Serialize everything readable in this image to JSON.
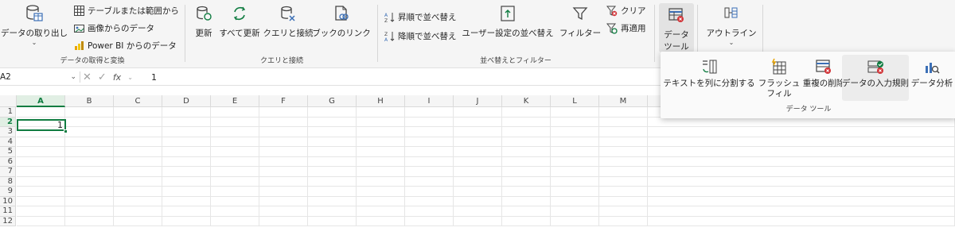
{
  "ribbon": {
    "get_data": {
      "group_label": "データの取得と変換",
      "get_data_label": "データの取り出し",
      "from_table": "テーブルまたは範囲から",
      "from_picture": "画像からのデータ",
      "from_powerbi": "Power BI からのデータ"
    },
    "queries": {
      "group_label": "クエリと接続",
      "refresh": "更新",
      "refresh_all": "すべて更新",
      "queries_connections": "クエリと接続",
      "workbook_links": "ブックのリンク"
    },
    "sort_filter": {
      "group_label": "並べ替えとフィルター",
      "sort_asc": "昇順で並べ替え",
      "sort_desc": "降順で並べ替え",
      "custom_sort": "ユーザー設定の並べ替え",
      "filter": "フィルター",
      "clear": "クリア",
      "reapply": "再適用"
    },
    "data_tools": {
      "label_line1": "データ",
      "label_line2": "ツール"
    },
    "outline": {
      "label": "アウトライン"
    }
  },
  "popup": {
    "group_label": "データ ツール",
    "text_to_columns": "テキストを列に分割する",
    "flash_fill_line1": "フラッシュ",
    "flash_fill_line2": "フィル",
    "remove_duplicates": "重複の削除",
    "data_validation": "データの入力規則",
    "data_analysis": "データ分析"
  },
  "formula_bar": {
    "name_box": "A2",
    "fx": "fx",
    "content": "1"
  },
  "sheet": {
    "columns": [
      "A",
      "B",
      "C",
      "D",
      "E",
      "F",
      "G",
      "H",
      "I",
      "J",
      "K",
      "L",
      "M"
    ],
    "rows": [
      "1",
      "2",
      "3",
      "4",
      "5",
      "6",
      "7",
      "8",
      "9",
      "10",
      "11",
      "12"
    ],
    "active_value": "1"
  },
  "colors": {
    "accent": "#107c41",
    "ribbon_bg": "#f5f5f5",
    "icon_blue": "#3b6fb6",
    "icon_red": "#d13438",
    "icon_green": "#107c41"
  }
}
